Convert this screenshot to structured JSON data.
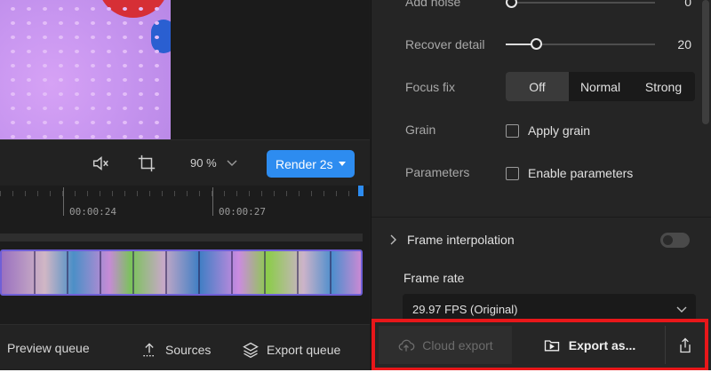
{
  "preview": {
    "zoom": "90 %",
    "render_label": "Render 2s"
  },
  "timeline": {
    "timecodes": [
      "00:00:24",
      "00:00:27"
    ]
  },
  "bottom_left": {
    "preview_queue": "Preview queue",
    "sources": "Sources",
    "export_queue": "Export queue"
  },
  "settings": {
    "add_noise": {
      "label": "Add noise",
      "value": "0"
    },
    "recover_detail": {
      "label": "Recover detail",
      "value": "20",
      "level": 0.2
    },
    "focus_fix": {
      "label": "Focus fix",
      "options": [
        "Off",
        "Normal",
        "Strong"
      ],
      "selected": "Off"
    },
    "grain": {
      "label": "Grain",
      "checkbox": "Apply grain",
      "checked": false
    },
    "parameters": {
      "label": "Parameters",
      "checkbox": "Enable parameters",
      "checked": false
    },
    "frame_interpolation": {
      "label": "Frame interpolation",
      "enabled": false
    },
    "frame_rate": {
      "label": "Frame rate",
      "value": "29.97 FPS (Original)"
    }
  },
  "export": {
    "cloud_label": "Cloud export",
    "export_as_label": "Export as...",
    "highlight_color": "#e8171a"
  },
  "colors": {
    "accent": "#2d8cf0",
    "background": "#1e1e1e"
  }
}
